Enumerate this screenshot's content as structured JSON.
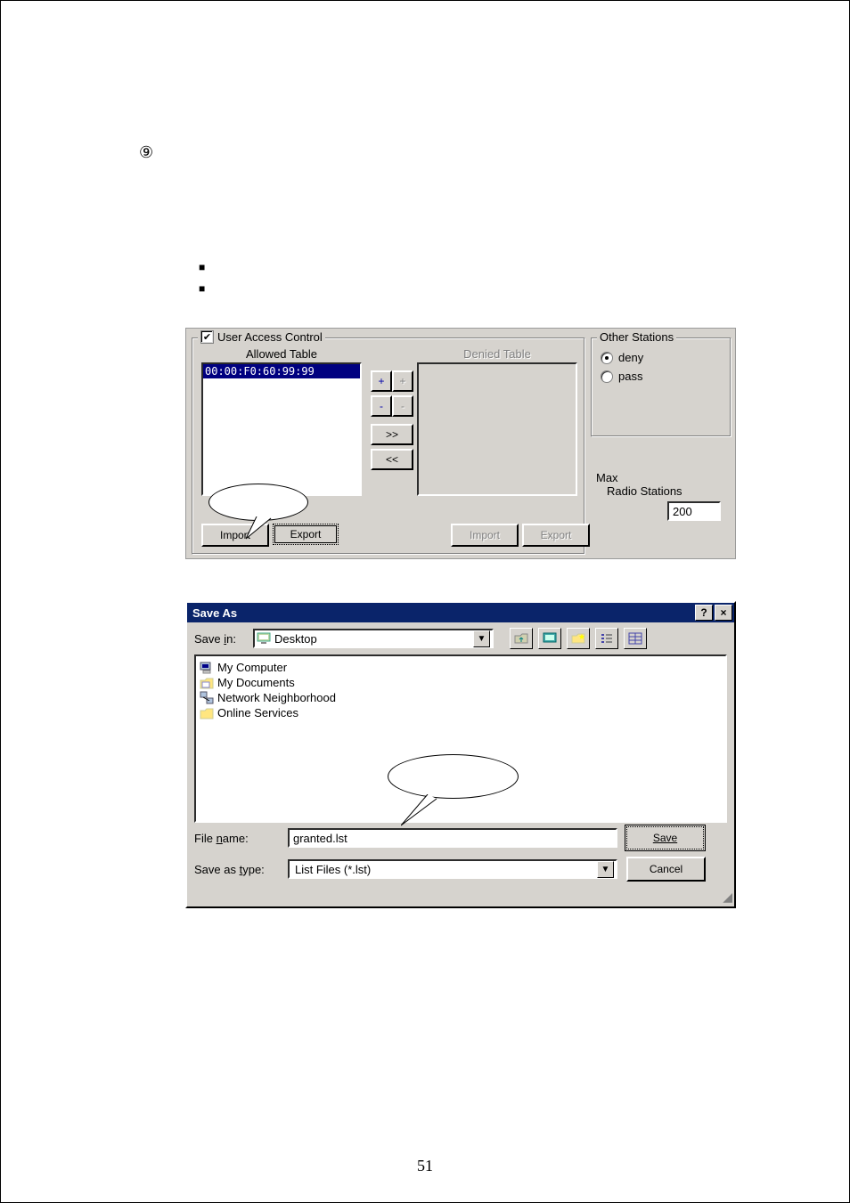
{
  "page_number": "51",
  "marker": "⑨",
  "bullets": [
    "",
    ""
  ],
  "uac": {
    "title": "User Access Control",
    "checked": "✔",
    "allowed_title": "Allowed Table",
    "denied_title": "Denied Table",
    "allowed_items": [
      "00:00:F0:60:99:99"
    ],
    "btn_plus": "+",
    "btn_plus_disabled": "+",
    "btn_minus": "-",
    "btn_minus_disabled": "-",
    "btn_right": ">>",
    "btn_left": "<<",
    "import": "Import",
    "export": "Export",
    "other_stations_title": "Other Stations",
    "radio_deny": "deny",
    "radio_pass": "pass",
    "max_label": "Max\n  Radio Stations",
    "max_label1": "Max",
    "max_label2": "Radio Stations",
    "max_value": "200"
  },
  "saveas": {
    "title": "Save As",
    "help": "?",
    "close": "×",
    "save_in_label": "Save in:",
    "save_in_value": "Desktop",
    "items": [
      {
        "icon": "computer",
        "label": "My Computer"
      },
      {
        "icon": "folder-mydocs",
        "label": "My Documents"
      },
      {
        "icon": "network",
        "label": "Network Neighborhood"
      },
      {
        "icon": "folder",
        "label": "Online Services"
      }
    ],
    "filename_label": "File name:",
    "filename_value": "granted.lst",
    "type_label": "Save as type:",
    "type_value": "List Files (*.lst)",
    "save_btn": "Save",
    "cancel_btn": "Cancel"
  }
}
